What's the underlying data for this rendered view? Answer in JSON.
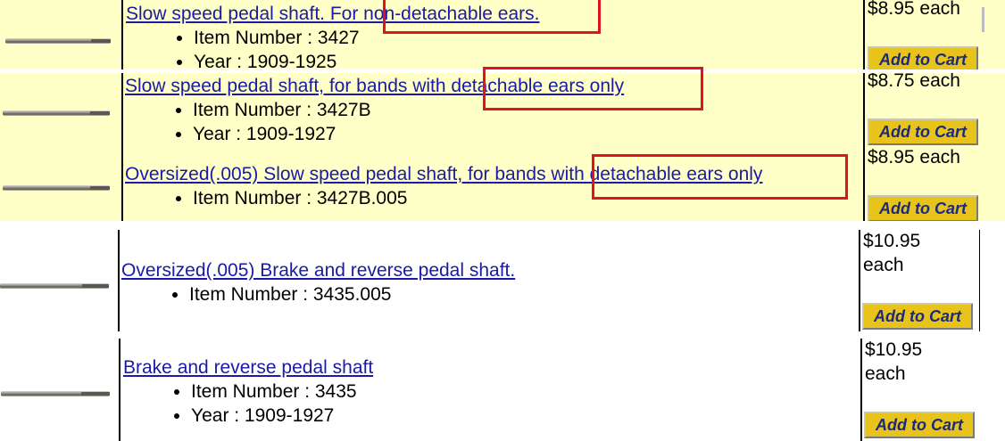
{
  "items": [
    {
      "title": "Slow speed pedal shaft. For non-detachable ears.",
      "item_label": "Item Number : 3427",
      "year_label": "Year : 1909-1925",
      "price": "$8.95 each",
      "cart": "Add to Cart"
    },
    {
      "title": "Slow speed pedal shaft, for bands with detachable ears only",
      "item_label": "Item Number : 3427B",
      "year_label": "Year : 1909-1927",
      "price": "$8.75 each",
      "cart": "Add to Cart"
    },
    {
      "title": "Oversized(.005) Slow speed pedal shaft, for bands with detachable ears only",
      "item_label": "Item Number : 3427B.005",
      "price": "$8.95 each",
      "cart": "Add to Cart"
    },
    {
      "title": "Oversized(.005) Brake and reverse pedal shaft.",
      "item_label": "Item Number : 3435.005",
      "price_line1": "$10.95",
      "price_line2": "each",
      "cart": "Add to Cart"
    },
    {
      "title": "Brake and reverse pedal shaft",
      "item_label": "Item Number : 3435",
      "year_label": "Year : 1909-1927",
      "price_line1": "$10.95",
      "price_line2": "each",
      "cart": "Add to Cart"
    }
  ],
  "colors": {
    "row_highlight": "#ffffc8",
    "link": "#1a1aa6",
    "cart_button": "#e8c31c",
    "annotation_box": "#e0151c"
  }
}
